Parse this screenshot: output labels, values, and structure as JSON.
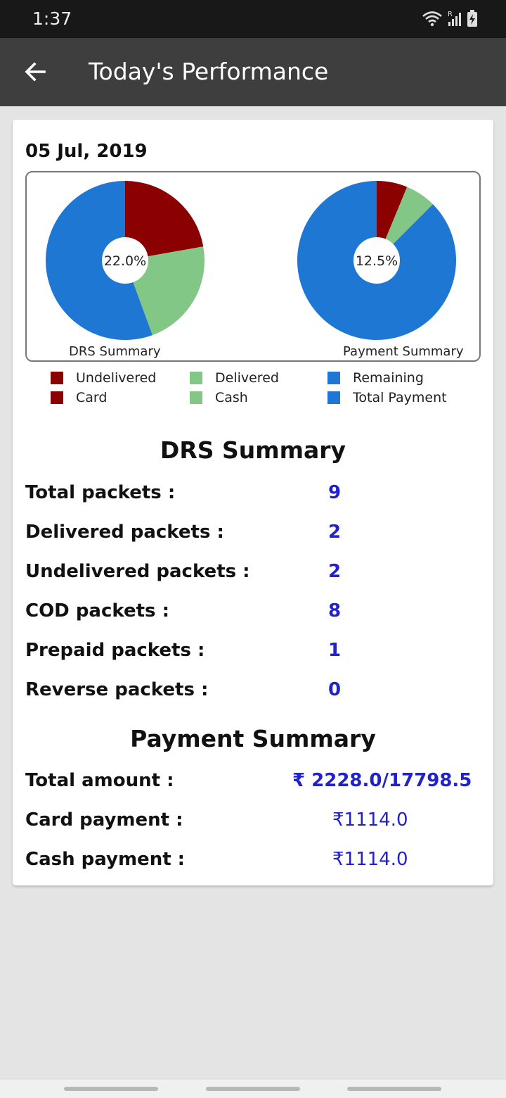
{
  "status_bar": {
    "time": "1:37",
    "icons": [
      "wifi-icon",
      "signal-icon",
      "battery-icon"
    ]
  },
  "app_bar": {
    "title": "Today's Performance",
    "back_icon": "arrow-left-icon"
  },
  "date": "05 Jul, 2019",
  "colors": {
    "red": "#8b0000",
    "green": "#82c785",
    "blue": "#1f77d4",
    "value_text": "#2222cc"
  },
  "chart_data": [
    {
      "type": "pie",
      "caption": "DRS Summary",
      "center_label": "22.0%",
      "slices": [
        {
          "label": "Undelivered",
          "value": 22.2,
          "color": "#8b0000"
        },
        {
          "label": "Delivered",
          "value": 22.2,
          "color": "#82c785"
        },
        {
          "label": "Remaining",
          "value": 55.6,
          "color": "#1f77d4"
        }
      ]
    },
    {
      "type": "pie",
      "caption": "Payment Summary",
      "center_label": "12.5%",
      "slices": [
        {
          "label": "Card",
          "value": 6.25,
          "color": "#8b0000"
        },
        {
          "label": "Cash",
          "value": 6.25,
          "color": "#82c785"
        },
        {
          "label": "Total Payment",
          "value": 87.5,
          "color": "#1f77d4"
        }
      ]
    }
  ],
  "legend": [
    {
      "label": "Undelivered",
      "color": "#8b0000"
    },
    {
      "label": "Delivered",
      "color": "#82c785"
    },
    {
      "label": "Remaining",
      "color": "#1f77d4"
    },
    {
      "label": "Card",
      "color": "#8b0000"
    },
    {
      "label": "Cash",
      "color": "#82c785"
    },
    {
      "label": "Total Payment",
      "color": "#1f77d4"
    }
  ],
  "drs_summary": {
    "title": "DRS Summary",
    "rows": [
      {
        "label": "Total packets :",
        "value": "9"
      },
      {
        "label": "Delivered packets :",
        "value": "2"
      },
      {
        "label": "Undelivered packets :",
        "value": "2"
      },
      {
        "label": "COD packets :",
        "value": "8"
      },
      {
        "label": "Prepaid packets :",
        "value": "1"
      },
      {
        "label": "Reverse packets :",
        "value": "0"
      }
    ]
  },
  "payment_summary": {
    "title": "Payment Summary",
    "rows": [
      {
        "label": "Total amount :",
        "value": "₹ 2228.0/17798.5"
      },
      {
        "label": "Card payment :",
        "value": "₹1114.0"
      },
      {
        "label": "Cash payment :",
        "value": "₹1114.0"
      }
    ]
  }
}
